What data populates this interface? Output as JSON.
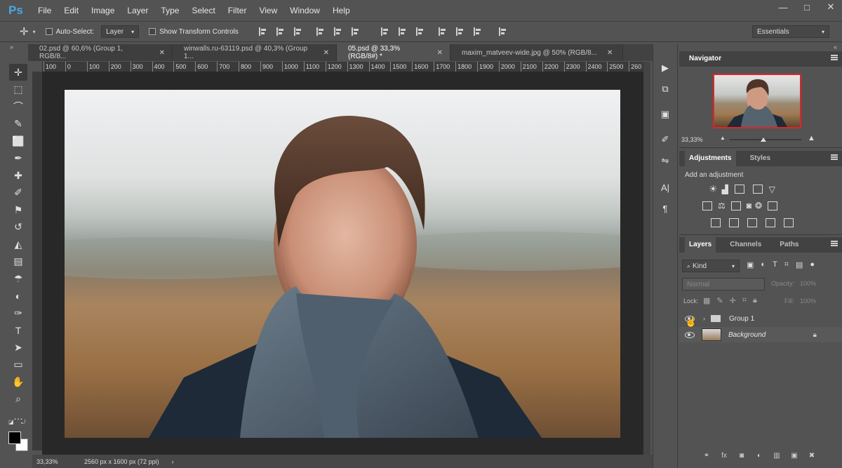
{
  "app": {
    "logo": "Ps",
    "menu": [
      "File",
      "Edit",
      "Image",
      "Layer",
      "Type",
      "Select",
      "Filter",
      "View",
      "Window",
      "Help"
    ],
    "window_controls": {
      "minimize": "—",
      "maximize": "□",
      "close": "✕"
    }
  },
  "options_bar": {
    "auto_select_label": "Auto-Select:",
    "auto_select_value": "Layer",
    "show_transform_label": "Show Transform Controls",
    "workspace": "Essentials"
  },
  "tabs": [
    {
      "label": "02.psd @ 60,6% (Group 1, RGB/8...",
      "close": "✕",
      "active": false
    },
    {
      "label": "winwalls.ru-63119.psd @ 40,3% (Group 1...",
      "close": "✕",
      "active": false
    },
    {
      "label": "05.psd @ 33,3% (RGB/8#) *",
      "close": "✕",
      "active": true
    },
    {
      "label": "maxim_matveev-wide.jpg @ 50% (RGB/8...",
      "close": "✕",
      "active": false
    }
  ],
  "ruler": {
    "labels": [
      "100",
      "0",
      "100",
      "200",
      "300",
      "400",
      "500",
      "600",
      "700",
      "800",
      "900",
      "1000",
      "1100",
      "1200",
      "1300",
      "1400",
      "1500",
      "1600",
      "1700",
      "1800",
      "1900",
      "2000",
      "2100",
      "2200",
      "2300",
      "2400",
      "2500",
      "260"
    ]
  },
  "tools": [
    "move-tool",
    "marquee-tool",
    "lasso-tool",
    "quick-select-tool",
    "crop-tool",
    "eyedropper-tool",
    "healing-tool",
    "brush-tool",
    "stamp-tool",
    "history-brush-tool",
    "eraser-tool",
    "gradient-tool",
    "blur-tool",
    "dodge-tool",
    "pen-tool",
    "type-tool",
    "path-select-tool",
    "shape-tool",
    "hand-tool",
    "zoom-tool",
    "more-tools"
  ],
  "tool_glyphs": [
    "✛",
    "⬚",
    "⌒",
    "✎",
    "⬜",
    "✒",
    "✚",
    "✐",
    "⚑",
    "↺",
    "◭",
    "▤",
    "☂",
    "◐",
    "✑",
    "T",
    "➤",
    "▭",
    "✋",
    "⌕",
    "…"
  ],
  "status": {
    "zoom": "33,33%",
    "doc_size": "2560 px x 1600 px (72 ppi)",
    "arrow": "›"
  },
  "navigator": {
    "title": "Navigator",
    "zoom": "33,33%"
  },
  "adjustments": {
    "tab_active": "Adjustments",
    "tab_other": "Styles",
    "add_label": "Add an adjustment"
  },
  "layers_panel": {
    "tabs": [
      "Layers",
      "Channels",
      "Paths"
    ],
    "filter_kind": "Kind",
    "blend_mode": "Normal",
    "opacity_label": "Opacity:",
    "opacity_value": "100%",
    "lock_label": "Lock:",
    "fill_label": "Fill:",
    "fill_value": "100%",
    "layers": [
      {
        "name": "Group 1",
        "type": "group"
      },
      {
        "name": "Background",
        "type": "image",
        "locked": true
      }
    ],
    "bottom_icons": [
      "link-icon",
      "fx-icon",
      "mask-icon",
      "adjustment-layer-icon",
      "folder-icon",
      "new-layer-icon",
      "trash-icon"
    ],
    "bottom_glyphs": [
      "⚭",
      "fx",
      "◙",
      "◐",
      "▥",
      "▣",
      "✖"
    ]
  },
  "colors": {
    "accent_red": "#e02424",
    "fg": "#000000",
    "bg": "#ffffff"
  }
}
